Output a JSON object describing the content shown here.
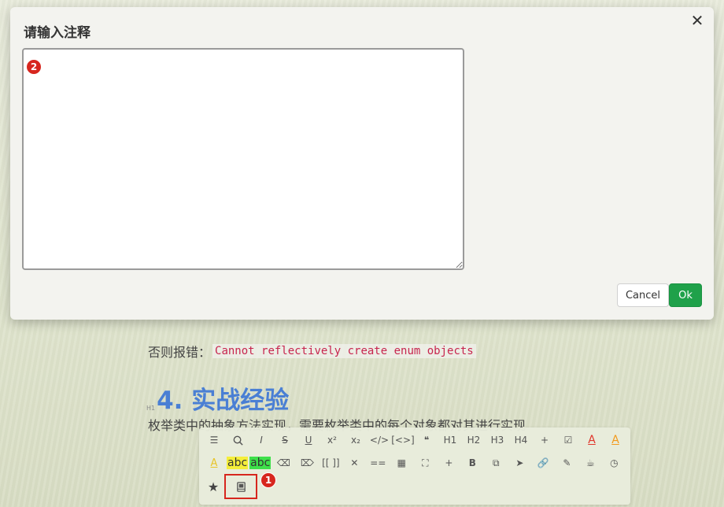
{
  "document": {
    "line1_prefix": "否则报错：",
    "line1_code": "Cannot reflectively create enum objects",
    "heading_tag": "H1",
    "heading": "4. 实战经验",
    "paragraph": "枚举类中的抽象方法实现，需要枚举类中的每个对象都对其进行实现"
  },
  "toolbar": {
    "row1": [
      {
        "name": "list-icon",
        "glyph": "☰"
      },
      {
        "name": "search-icon",
        "glyph": "search"
      },
      {
        "name": "italic-icon",
        "glyph": "I"
      },
      {
        "name": "strikethrough-icon",
        "glyph": "S"
      },
      {
        "name": "underline-icon",
        "glyph": "U"
      },
      {
        "name": "superscript-icon",
        "glyph": "x²"
      },
      {
        "name": "subscript-icon",
        "glyph": "x₂"
      },
      {
        "name": "inline-code-icon",
        "glyph": "</>"
      },
      {
        "name": "code-block-icon",
        "glyph": "[<>]"
      },
      {
        "name": "quote-icon",
        "glyph": "❝"
      },
      {
        "name": "heading1-icon",
        "glyph": "H1"
      },
      {
        "name": "heading2-icon",
        "glyph": "H2"
      },
      {
        "name": "heading3-icon",
        "glyph": "H3"
      },
      {
        "name": "heading4-icon",
        "glyph": "H4"
      },
      {
        "name": "insert-file-icon",
        "glyph": "+"
      },
      {
        "name": "checkbox-icon",
        "glyph": "☑"
      },
      {
        "name": "font-color-red-icon",
        "glyph": "A"
      },
      {
        "name": "font-color-orange-icon",
        "glyph": "A"
      }
    ],
    "row2_first": {
      "name": "font-color-yellow-icon",
      "glyph": "A"
    },
    "highlight_yellow": "abc",
    "highlight_green": "abc",
    "row2_rest": [
      {
        "name": "eraser-icon",
        "glyph": "⌫"
      },
      {
        "name": "clear-format-icon",
        "glyph": "⌦"
      },
      {
        "name": "wikilink-icon",
        "glyph": "[[ ]]"
      },
      {
        "name": "close-format-icon",
        "glyph": "✕"
      },
      {
        "name": "mark-icon",
        "glyph": "=="
      },
      {
        "name": "table-icon",
        "glyph": "▦"
      },
      {
        "name": "scan-icon",
        "glyph": "⛶"
      },
      {
        "name": "new-note-icon",
        "glyph": "+"
      },
      {
        "name": "bold-icon",
        "glyph": "B"
      },
      {
        "name": "copy-icon",
        "glyph": "⧉"
      },
      {
        "name": "send-icon",
        "glyph": "➤"
      },
      {
        "name": "link-icon",
        "glyph": "🔗"
      },
      {
        "name": "pen-icon",
        "glyph": "✎"
      },
      {
        "name": "coffee-icon",
        "glyph": "☕"
      },
      {
        "name": "clock-icon",
        "glyph": "◷"
      }
    ],
    "row3": [
      {
        "name": "star-icon",
        "glyph": "★"
      },
      {
        "name": "annotation-book-icon",
        "glyph": "book"
      }
    ],
    "marker1": "1"
  },
  "modal": {
    "title": "请输入注释",
    "close_glyph": "✕",
    "textarea_value": "",
    "marker2": "2",
    "cancel_label": "Cancel",
    "ok_label": "Ok"
  },
  "colors": {
    "accent_green": "#1fa14a",
    "marker_red": "#d7261e",
    "heading_blue": "#4a7fd4",
    "code_red": "#c7254e"
  }
}
